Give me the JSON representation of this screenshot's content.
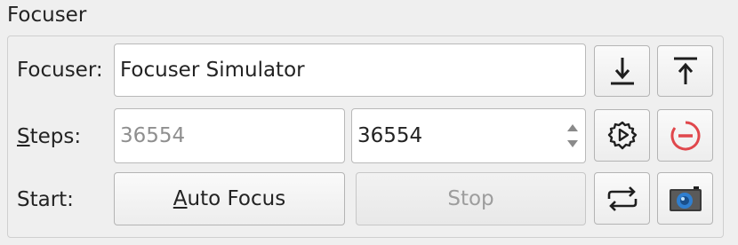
{
  "group": {
    "title": "Focuser"
  },
  "labels": {
    "focuser": "Focuser:",
    "steps_mnemonic": "S",
    "steps_rest": "teps:",
    "start": "Start:"
  },
  "focuser_name": "Focuser Simulator",
  "steps": {
    "current": "36554",
    "target": "36554"
  },
  "buttons": {
    "auto_focus_mnemonic": "A",
    "auto_focus_rest": "uto Focus",
    "stop": "Stop"
  },
  "icons": {
    "focus_in": "download-arrow-icon",
    "focus_out": "upload-arrow-icon",
    "goto": "gear-play-icon",
    "abort": "stop-circle-icon",
    "loop": "loop-arrows-icon",
    "capture": "camera-icon"
  },
  "colors": {
    "abort_red": "#e0474c",
    "camera_blue": "#2f7fd0"
  }
}
